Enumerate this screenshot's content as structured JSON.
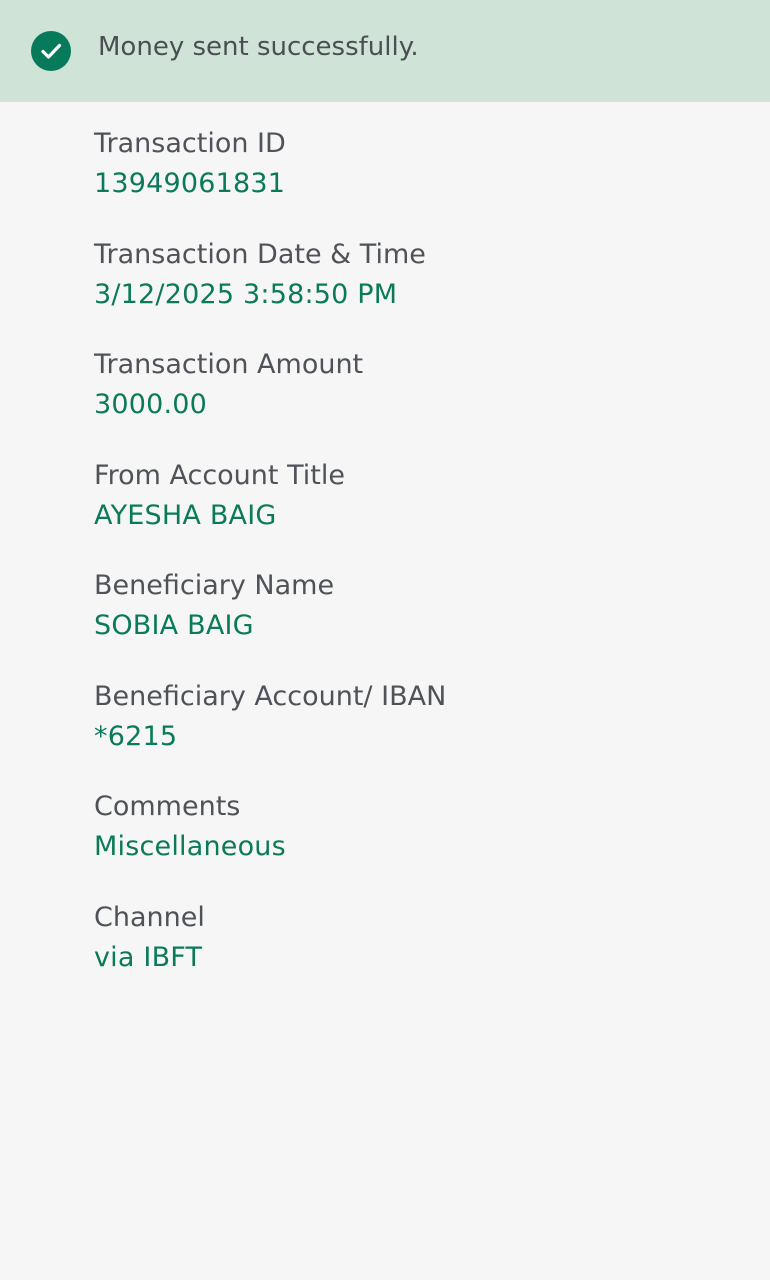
{
  "banner": {
    "icon": "check-circle-icon",
    "message": "Money sent successfully."
  },
  "colors": {
    "banner_background": "#cfe4d6",
    "accent": "#0b7a5a",
    "label": "#4f5359",
    "page_background": "#f6f6f6"
  },
  "fields": [
    {
      "label": "Transaction ID",
      "value": "13949061831"
    },
    {
      "label": "Transaction Date & Time",
      "value": "3/12/2025 3:58:50 PM"
    },
    {
      "label": "Transaction Amount",
      "value": "3000.00"
    },
    {
      "label": "From Account Title",
      "value": "AYESHA BAIG"
    },
    {
      "label": "Beneficiary Name",
      "value": "SOBIA BAIG"
    },
    {
      "label": "Beneficiary Account/ IBAN",
      "value": "*6215"
    },
    {
      "label": "Comments",
      "value": "Miscellaneous"
    },
    {
      "label": "Channel",
      "value": "via IBFT"
    }
  ]
}
